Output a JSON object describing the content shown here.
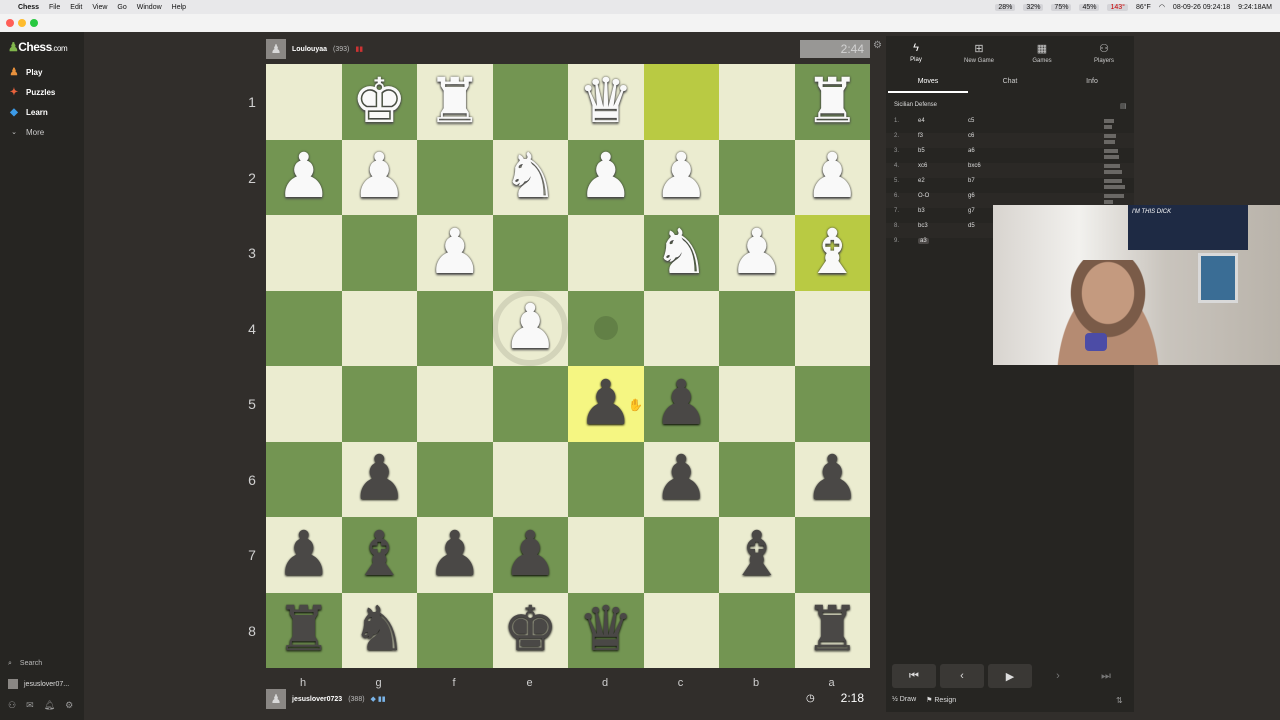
{
  "menubar": {
    "app": "Chess",
    "menus": [
      "File",
      "Edit",
      "View",
      "Go",
      "Window",
      "Help"
    ],
    "stats": [
      "28%",
      "32%",
      "75%",
      "45%",
      "143°",
      "86°F"
    ],
    "datetime": "08-09-26 09:24:18",
    "clock": "9:24:18AM"
  },
  "sidebar": {
    "logo": "Chess",
    "logo_suffix": ".com",
    "items": [
      {
        "label": "Play",
        "icon": "play-icon"
      },
      {
        "label": "Puzzles",
        "icon": "puzzle-icon"
      },
      {
        "label": "Learn",
        "icon": "learn-icon"
      },
      {
        "label": "More",
        "icon": "chevron-down-icon"
      }
    ],
    "search_label": "Search",
    "username": "jesuslover07..."
  },
  "top_player": {
    "name": "Loulouyaa",
    "rating": "(393)",
    "clock": "2:44"
  },
  "bottom_player": {
    "name": "jesuslover0723",
    "rating": "(388)",
    "clock": "2:18"
  },
  "board": {
    "ranks": [
      "1",
      "2",
      "3",
      "4",
      "5",
      "6",
      "7",
      "8"
    ],
    "files": [
      "h",
      "g",
      "f",
      "e",
      "d",
      "c",
      "b",
      "a"
    ],
    "pieces": [
      [
        "",
        "wK",
        "wR",
        "",
        "wQ",
        "",
        "",
        "wR"
      ],
      [
        "wP",
        "wP",
        "",
        "wN",
        "wP",
        "wP",
        "",
        "wP"
      ],
      [
        "",
        "",
        "wP",
        "",
        "",
        "wN",
        "wP",
        "wB"
      ],
      [
        "",
        "",
        "",
        "wP",
        "",
        "",
        "",
        ""
      ],
      [
        "",
        "",
        "",
        "",
        "bP",
        "bP",
        "",
        ""
      ],
      [
        "",
        "bP",
        "",
        "",
        "",
        "bP",
        "",
        "bP"
      ],
      [
        "bP",
        "bB",
        "bP",
        "bP",
        "",
        "",
        "bB",
        ""
      ],
      [
        "bR",
        "bN",
        "",
        "bK",
        "bQ",
        "",
        "",
        "bR"
      ]
    ],
    "highlights": [
      "0-5",
      "2-7",
      "4-4"
    ],
    "hint_ring": "3-3",
    "hint_dot": "3-4"
  },
  "panel": {
    "tabs": [
      {
        "label": "Play",
        "icon": "bolt-icon"
      },
      {
        "label": "New Game",
        "icon": "plus-icon"
      },
      {
        "label": "Games",
        "icon": "board-icon"
      },
      {
        "label": "Players",
        "icon": "players-icon"
      }
    ],
    "subtabs": [
      "Moves",
      "Chat",
      "Info"
    ],
    "opening": "Sicilian Defense",
    "moves": [
      {
        "num": "1.",
        "white": "e4",
        "black": "c5"
      },
      {
        "num": "2.",
        "white": "f3",
        "black": "c6"
      },
      {
        "num": "3.",
        "white": "b5",
        "black": "a6"
      },
      {
        "num": "4.",
        "white": "xc6",
        "black": "bxc6"
      },
      {
        "num": "5.",
        "white": "e2",
        "black": "b7"
      },
      {
        "num": "6.",
        "white": "O-O",
        "black": "g6"
      },
      {
        "num": "7.",
        "white": "b3",
        "black": "g7"
      },
      {
        "num": "8.",
        "white": "bc3",
        "black": "d5"
      },
      {
        "num": "9.",
        "white": "a3",
        "black": ""
      }
    ],
    "controls": [
      "first-icon",
      "prev-icon",
      "next-play-icon",
      "next-icon",
      "last-icon"
    ],
    "draw_label": "Draw",
    "draw_prefix": "½",
    "resign_label": "Resign"
  },
  "webcam": {
    "poster_text": "I'M THIS DICK"
  }
}
